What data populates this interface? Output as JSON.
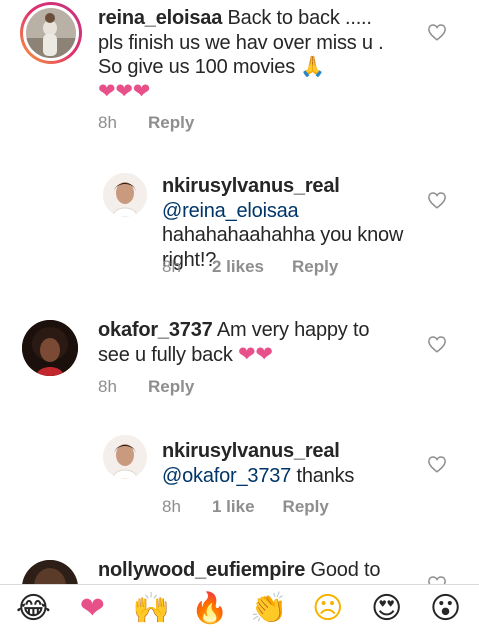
{
  "comments": [
    {
      "username": "reina_eloisaa",
      "body": "Back to back ..... pls finish us we hav over miss u . So give us 100 movies",
      "emoji": "🙏",
      "hearts": "❤❤❤",
      "time": "8h",
      "reply": "Reply"
    },
    {
      "username": "nkirusylvanus_real",
      "mention": "@reina_eloisaa",
      "body": "hahahahaahahha you know right!?",
      "time": "8h",
      "likes": "2 likes",
      "reply": "Reply"
    },
    {
      "username": "okafor_3737",
      "body": "Am very happy to see u fully back",
      "hearts": "❤❤",
      "time": "8h",
      "reply": "Reply"
    },
    {
      "username": "nkirusylvanus_real",
      "mention": "@okafor_3737",
      "body": "thanks",
      "time": "8h",
      "likes": "1 like",
      "reply": "Reply"
    },
    {
      "username": "nollywood_eufiempire",
      "body": "Good to"
    }
  ],
  "emoji_bar": [
    {
      "name": "laughing-face",
      "glyph": "😂"
    },
    {
      "name": "heart",
      "glyph": "❤"
    },
    {
      "name": "raised-hands",
      "glyph": "🙌"
    },
    {
      "name": "fire",
      "glyph": "🔥"
    },
    {
      "name": "clapping-hands",
      "glyph": "👏"
    },
    {
      "name": "sad-face",
      "glyph": "☹"
    },
    {
      "name": "heart-eyes",
      "glyph": "😍"
    },
    {
      "name": "surprised-face",
      "glyph": "😮"
    }
  ],
  "colors": {
    "heart": "#e8508a",
    "mention": "#003569",
    "meta": "#8e8e8e",
    "story_ring": "#e1306c"
  }
}
